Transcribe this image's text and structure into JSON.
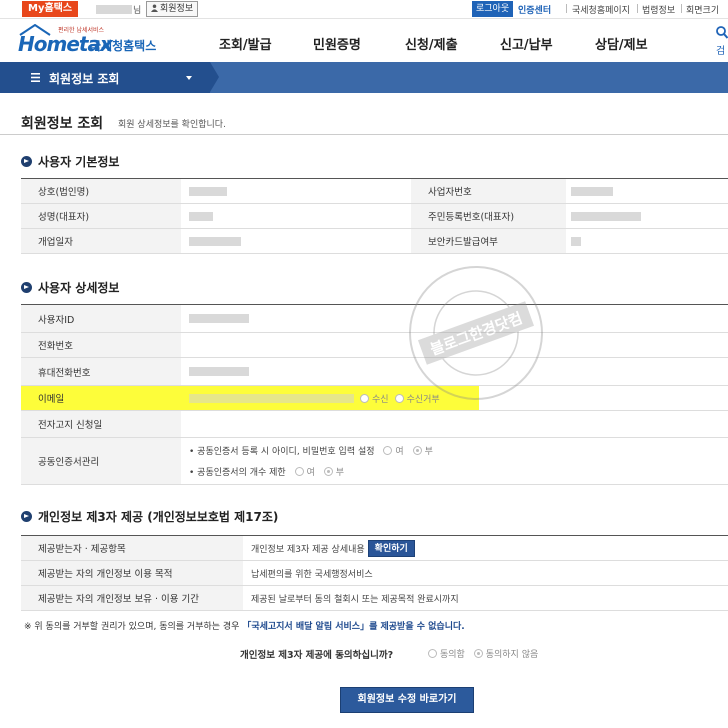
{
  "topbar": {
    "my_hometax": "My홈택스",
    "name_suffix": "님",
    "member_info": "회원정보",
    "logout": "로그아웃",
    "cert_center": "인증센터",
    "links": [
      "국세청홈페이지",
      "법령정보",
      "회면크기"
    ]
  },
  "header": {
    "logo_tagline": "편리한 납세서비스",
    "logo_home": "Hometax",
    "logo_kor": "국세청홈택스",
    "gnb": [
      "조회/발급",
      "민원증명",
      "신청/제출",
      "신고/납부",
      "상담/제보"
    ],
    "search_label": "검"
  },
  "nav": {
    "menu_title": "회원정보 조회"
  },
  "page": {
    "title": "회원정보 조회",
    "desc": "회원 상세정보를 확인합니다."
  },
  "basic": {
    "heading": "사용자 기본정보",
    "rows": [
      {
        "l1": "상호(법인명)",
        "l2": "사업자번호"
      },
      {
        "l1": "성명(대표자)",
        "l2": "주민등록번호(대표자)"
      },
      {
        "l1": "개업일자",
        "l2": "보안카드발급여부"
      }
    ]
  },
  "detail": {
    "heading": "사용자 상세정보",
    "user_id": "사용자ID",
    "phone": "전화번호",
    "mobile": "휴대전화번호",
    "email": "이메일",
    "email_opt_in": "수신",
    "email_opt_out": "수신거부",
    "e_notice": "전자고지 신청일",
    "cert_mgmt": "공동인증서관리",
    "cert_line1": "• 공동인증서 등록 시 아이디, 비밀번호 입력 설정",
    "cert_line2": "• 공동인증서의 개수 제한",
    "yes": "여",
    "no": "부"
  },
  "privacy": {
    "heading": "개인정보 제3자 제공 (개인정보보호법 제17조)",
    "rows": [
      {
        "label": "제공받는자 · 제공항목",
        "value": "개인정보 제3자 제공 상세내용",
        "button": "확인하기"
      },
      {
        "label": "제공받는 자의 개인정보 이용 목적",
        "value": "납세편의를 위한 국세행정서비스"
      },
      {
        "label": "제공받는 자의 개인정보 보유 · 이용 기간",
        "value": "제공된 날로부터 동의 철회시 또는 제공목적 완료시까지"
      }
    ],
    "notice_pre": "※ 위 동의를 거부할 권리가 있으며, 동의를 거부하는 경우 ",
    "notice_strong": "「국세고지서 배달 알림 서비스」를 제공받을 수 없습니다.",
    "agree_question": "개인정보 제3자 제공에 동의하십니까?",
    "agree": "동의함",
    "disagree": "동의하지 않음"
  },
  "action": {
    "main_button": "회원정보 수정 바로가기"
  },
  "watermark": {
    "text": "블로그한경닷컴"
  },
  "colors": {
    "brand_blue": "#1f63b7",
    "nav_blue": "#3b69a8",
    "nav_dark": "#234f8e",
    "accent_orange": "#e8471b",
    "highlight": "#fdfd3a"
  }
}
